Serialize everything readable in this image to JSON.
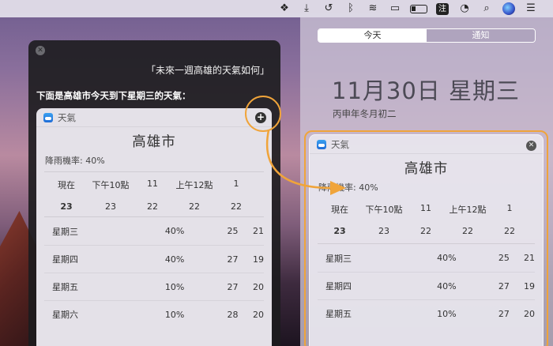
{
  "menubar": {
    "icons": [
      "dropbox-icon",
      "download-icon",
      "time-machine-icon",
      "bluetooth-icon",
      "wifi-icon",
      "airplay-icon",
      "battery-icon",
      "input-method-icon",
      "clock-icon",
      "search-icon",
      "siri-icon",
      "notification-center-icon"
    ],
    "input_method_label": "注"
  },
  "siri": {
    "query": "「未來一週高雄的天氣如何」",
    "answer": "下面是高雄市今天到下星期三的天氣：",
    "card": {
      "app_name": "天氣",
      "plus_symbol": "+"
    }
  },
  "weather": {
    "city": "高雄市",
    "rain_chance": "降雨機率: 40%",
    "hours": [
      "現在",
      "下午10點",
      "11",
      "上午12點",
      "1"
    ],
    "temps": [
      "23",
      "23",
      "22",
      "22",
      "22"
    ],
    "days": [
      {
        "name": "星期三",
        "rain": "40%",
        "hi": "25",
        "lo": "21"
      },
      {
        "name": "星期四",
        "rain": "40%",
        "hi": "27",
        "lo": "19"
      },
      {
        "name": "星期五",
        "rain": "10%",
        "hi": "27",
        "lo": "20"
      },
      {
        "name": "星期六",
        "rain": "10%",
        "hi": "28",
        "lo": "20"
      }
    ],
    "nc_days": [
      {
        "name": "星期三",
        "rain": "40%",
        "hi": "25",
        "lo": "21"
      },
      {
        "name": "星期四",
        "rain": "40%",
        "hi": "27",
        "lo": "19"
      },
      {
        "name": "星期五",
        "rain": "10%",
        "hi": "27",
        "lo": "20"
      }
    ]
  },
  "notification_center": {
    "tab_today": "今天",
    "tab_notifications": "通知",
    "date": "11月30日 星期三",
    "lunar_date": "丙申年冬月初二",
    "widget_title": "天氣",
    "close_symbol": "✕"
  },
  "colors": {
    "highlight": "#f0a43a"
  }
}
